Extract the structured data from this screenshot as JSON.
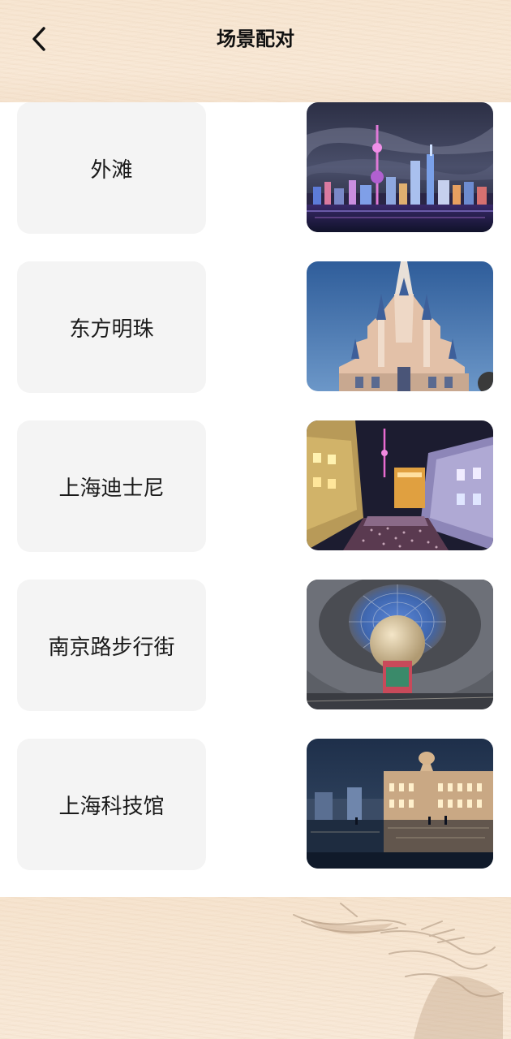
{
  "header": {
    "title": "场景配对",
    "back_icon": "chevron-left-icon"
  },
  "pairs": [
    {
      "label": "外滩",
      "image": "night-skyline-oriental-pearl-tower"
    },
    {
      "label": "东方明珠",
      "image": "disney-castle-blue-sky"
    },
    {
      "label": "上海迪士尼",
      "image": "nanjing-road-night-street-crowd"
    },
    {
      "label": "南京路步行街",
      "image": "science-museum-glass-dome-sphere"
    },
    {
      "label": "上海科技馆",
      "image": "bund-historic-building-night-reflection"
    }
  ],
  "colors": {
    "header_bg": "#f7e6d2",
    "card_bg": "#f4f4f4",
    "text": "#1a1a1a"
  }
}
